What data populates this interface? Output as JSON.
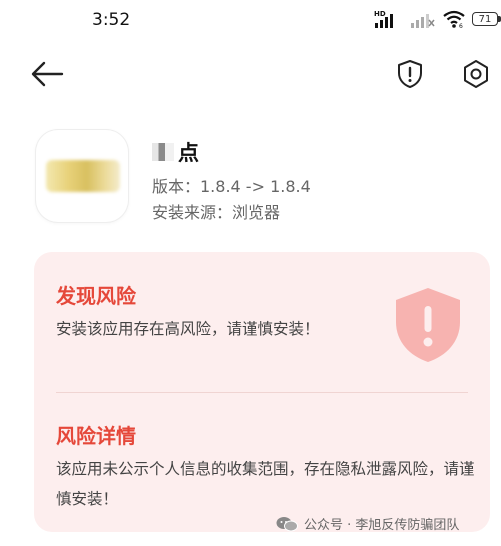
{
  "status_bar": {
    "time": "3:52",
    "network_label": "HD",
    "battery_level": "71"
  },
  "toolbar": {
    "back_icon": "back-arrow-icon",
    "warning_icon": "exclamation-shield-icon",
    "settings_icon": "hexagon-gear-icon"
  },
  "app": {
    "name": "点",
    "version": "版本：1.8.4 -> 1.8.4",
    "source": "安装来源：浏览器"
  },
  "risk": {
    "heading": "发现风险",
    "message": "安装该应用存在高风险，请谨慎安装！",
    "detail_heading": "风险详情",
    "detail_message": "该应用未公示个人信息的收集范围，存在隐私泄露风险，请谨慎安装！",
    "accent_color": "#e5483a",
    "card_color": "#fdeeee"
  },
  "watermark": {
    "text": "公众号 · 李旭反传防骗团队"
  }
}
